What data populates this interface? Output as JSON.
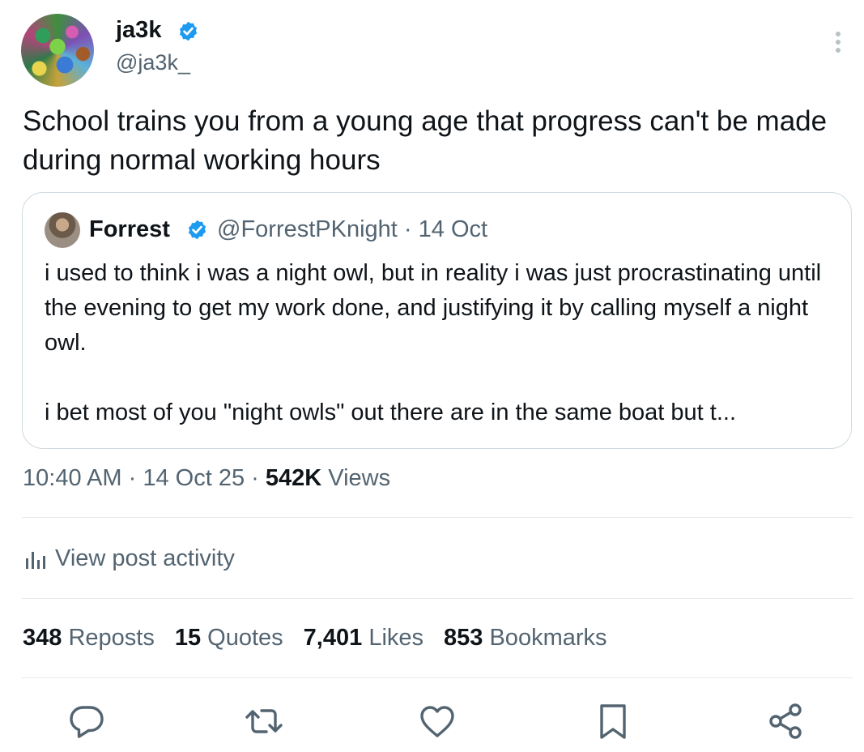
{
  "author": {
    "name": "ja3k",
    "handle": "@ja3k_",
    "verified_icon": "verified-badge-icon",
    "avatar": "colorful-abstract-avatar"
  },
  "tweet": {
    "text": "School trains you from a young age that progress can't be made during normal working hours"
  },
  "quote": {
    "name": "Forrest",
    "handle": "@ForrestPKnight",
    "separator": "·",
    "date": "14 Oct",
    "text": "i used to think i was a night owl, but in reality i was just procrastinating until the evening to get my work done, and justifying it by calling myself a night owl.\n\ni bet most of you \"night owls\" out there are in the same boat but t..."
  },
  "meta": {
    "time": "10:40 AM",
    "date": "14 Oct 25",
    "views_count": "542K",
    "views_label": "Views",
    "separator": "·"
  },
  "activity": {
    "label": "View post activity",
    "icon": "analytics-icon"
  },
  "stats": [
    {
      "count": "348",
      "label": "Reposts"
    },
    {
      "count": "15",
      "label": "Quotes"
    },
    {
      "count": "7,401",
      "label": "Likes"
    },
    {
      "count": "853",
      "label": "Bookmarks"
    }
  ],
  "actions": [
    "reply-icon",
    "repost-icon",
    "like-icon",
    "bookmark-icon",
    "share-icon"
  ],
  "colors": {
    "text": "#0f1419",
    "secondary": "#536471",
    "verified": "#1d9bf0",
    "border": "#cfd9de",
    "divider": "#e4e8eb"
  }
}
